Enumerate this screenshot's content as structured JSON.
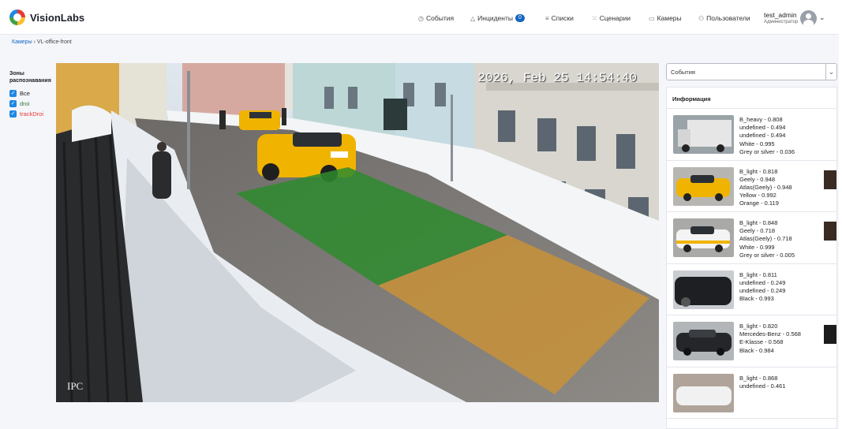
{
  "header": {
    "brand": "VisionLabs",
    "nav": [
      {
        "icon": "clock-icon",
        "glyph": "◷",
        "label": "События"
      },
      {
        "icon": "warning-icon",
        "glyph": "△",
        "label": "Инциденты",
        "badge": "0"
      },
      {
        "icon": "list-icon",
        "glyph": "≡",
        "label": "Списки"
      },
      {
        "icon": "scenario-icon",
        "glyph": "⁙",
        "label": "Сценарии"
      },
      {
        "icon": "camera-icon",
        "glyph": "▭",
        "label": "Камеры"
      },
      {
        "icon": "users-icon",
        "glyph": "⚇",
        "label": "Пользователи"
      }
    ],
    "user": {
      "name": "test_admin",
      "role": "Администратор"
    }
  },
  "breadcrumb": {
    "root": "Камеры",
    "separator": "›",
    "current": "VL-office-front"
  },
  "zones": {
    "title": "Зоны распознавания",
    "items": [
      {
        "label": "Все",
        "checked": true,
        "color": "#222222"
      },
      {
        "label": "droi",
        "checked": true,
        "color": "#2e7d32"
      },
      {
        "label": "trackDroi",
        "checked": true,
        "color": "#e53935"
      }
    ]
  },
  "video": {
    "timestamp": "2026, Feb 25 14:54:40",
    "watermark": "IPC"
  },
  "events_select": {
    "value": "События"
  },
  "info_panel": {
    "title": "Информация",
    "cards": [
      {
        "lines": [
          "B_heavy - 0.808",
          "undefined - 0.494",
          "undefined - 0.494",
          "White - 0.995",
          "Grey or silver - 0.036"
        ],
        "thumb_color": "#e8e8e8"
      },
      {
        "lines": [
          "B_light - 0.818",
          "Geely - 0.948",
          "Atlas(Geely) - 0.948",
          "Yellow - 0.992",
          "Orange - 0.119"
        ],
        "thumb_color": "#f2b700"
      },
      {
        "lines": [
          "B_light - 0.848",
          "Geely - 0.718",
          "Atlas(Geely) - 0.718",
          "White - 0.999",
          "Grey or silver - 0.005"
        ],
        "thumb_color": "#f5f5f5"
      },
      {
        "lines": [
          "B_light - 0.811",
          "undefined - 0.249",
          "undefined - 0.249",
          "Black - 0.993"
        ],
        "thumb_color": "#1e1f22"
      },
      {
        "lines": [
          "B_light - 0.820",
          "Mercedes-Benz - 0.568",
          "E-Klasse - 0.568",
          "Black - 0.984"
        ],
        "thumb_color": "#24262a"
      },
      {
        "lines": [
          "B_light - 0.868",
          "undefined - 0.461"
        ],
        "thumb_color": "#f1f1f1"
      }
    ]
  },
  "colors": {
    "accent": "#1565c0",
    "droi_zone": "#2e8b2e",
    "trackdroi_zone": "#d09030"
  }
}
